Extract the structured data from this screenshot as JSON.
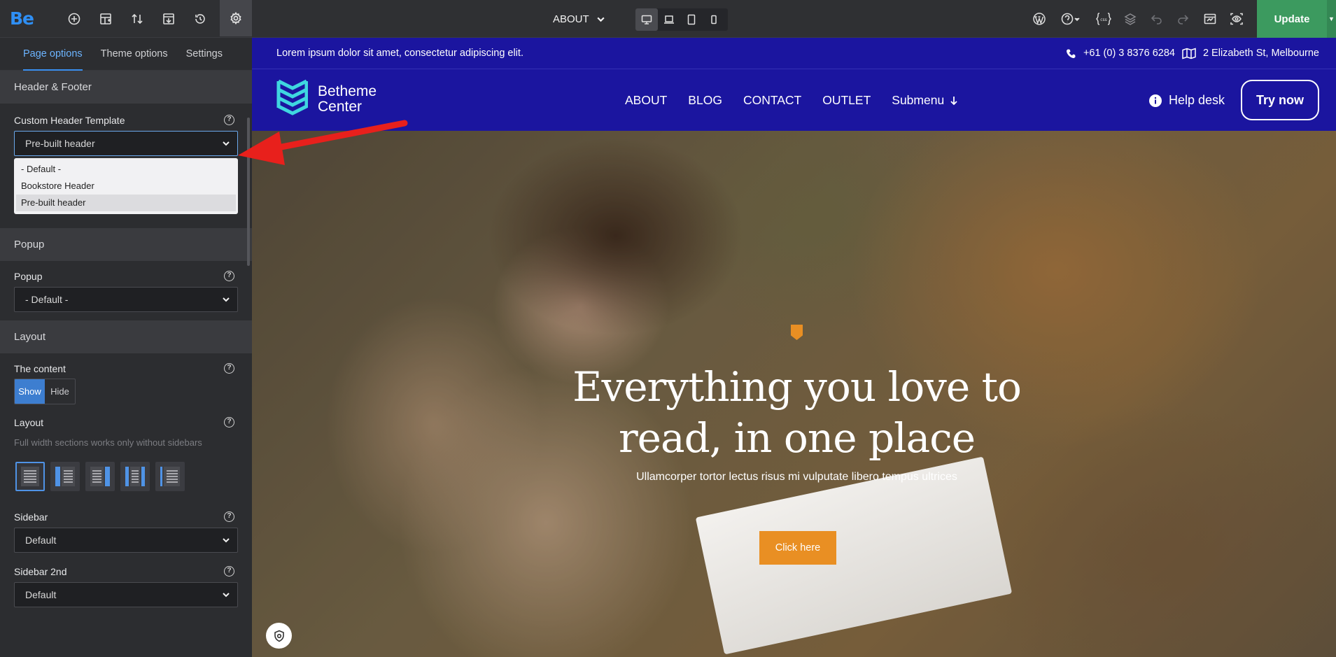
{
  "toolbar": {
    "brand": "Be",
    "page_selector": "ABOUT",
    "update_label": "Update",
    "icons": [
      "add-icon",
      "structure-icon",
      "sort-icon",
      "import-icon",
      "history-icon",
      "settings-icon"
    ],
    "right_icons": [
      "wordpress-icon",
      "help-icon",
      "css-icon",
      "layers-icon",
      "undo-icon",
      "redo-icon",
      "preview-icon",
      "eye-icon"
    ]
  },
  "sidebar": {
    "tabs": [
      "Page options",
      "Theme options",
      "Settings"
    ],
    "sections": {
      "header_footer": "Header & Footer",
      "popup": "Popup",
      "layout": "Layout"
    },
    "header_template": {
      "label": "Custom Header Template",
      "value": "Pre-built header",
      "options": [
        "- Default -",
        "Bookstore Header",
        "Pre-built header"
      ]
    },
    "popup": {
      "label": "Popup",
      "value": "- Default -"
    },
    "content": {
      "label": "The content",
      "show": "Show",
      "hide": "Hide"
    },
    "layout": {
      "label": "Layout",
      "hint": "Full width sections works only without sidebars"
    },
    "sidebar1": {
      "label": "Sidebar",
      "value": "Default"
    },
    "sidebar2": {
      "label": "Sidebar 2nd",
      "value": "Default"
    }
  },
  "site": {
    "topbar_text": "Lorem ipsum dolor sit amet, consectetur adipiscing elit.",
    "phone": "+61 (0) 3 8376 6284",
    "address": "2 Elizabeth St, Melbourne",
    "logo_line1": "Betheme",
    "logo_line2": "Center",
    "nav": [
      "ABOUT",
      "BLOG",
      "CONTACT",
      "OUTLET",
      "Submenu"
    ],
    "help_desk": "Help desk",
    "try_now": "Try now",
    "hero_title_1": "Everything you love to",
    "hero_title_2": "read, in one place",
    "hero_subtitle": "Ullamcorper tortor lectus risus mi vulputate libero tempus ultrices",
    "cta": "Click here"
  },
  "colors": {
    "accent": "#2f8ff5",
    "site_blue": "#1b159f",
    "orange": "#e98f23",
    "update_green": "#3c9a5f",
    "annotation_arrow": "#e8201c"
  }
}
